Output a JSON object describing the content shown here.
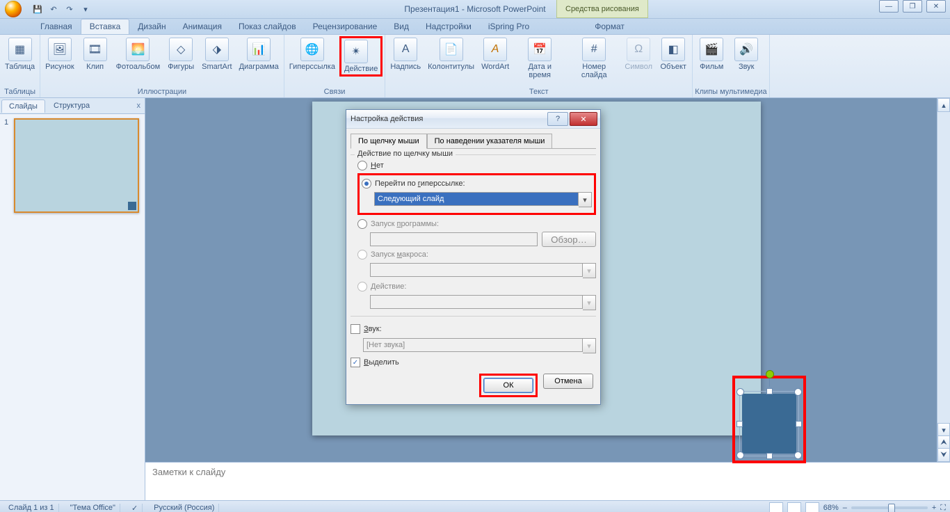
{
  "title": "Презентация1 - Microsoft PowerPoint",
  "drawing_tools_label": "Средства рисования",
  "win": {
    "minimize": "—",
    "restore": "❐",
    "close": "✕"
  },
  "qa": {
    "save": "💾",
    "undo": "↶",
    "redo": "↷",
    "more": "▾"
  },
  "tabs": {
    "home": "Главная",
    "insert": "Вставка",
    "design": "Дизайн",
    "animation": "Анимация",
    "slideshow": "Показ слайдов",
    "review": "Рецензирование",
    "view": "Вид",
    "addins": "Надстройки",
    "ispring": "iSpring Pro",
    "format": "Формат"
  },
  "ribbon": {
    "tables": {
      "title": "Таблицы",
      "table": "Таблица"
    },
    "illustrations": {
      "title": "Иллюстрации",
      "picture": "Рисунок",
      "clip": "Клип",
      "album": "Фотоальбом",
      "shapes": "Фигуры",
      "smartart": "SmartArt",
      "chart": "Диаграмма"
    },
    "links": {
      "title": "Связи",
      "hyperlink": "Гиперссылка",
      "action": "Действие"
    },
    "text": {
      "title": "Текст",
      "textbox": "Надпись",
      "header_footer": "Колонтитулы",
      "wordart": "WordArt",
      "datetime": "Дата и время",
      "slide_number": "Номер слайда",
      "symbol": "Символ",
      "object": "Объект"
    },
    "media": {
      "title": "Клипы мультимедиа",
      "movie": "Фильм",
      "sound": "Звук"
    }
  },
  "icons": {
    "table": "▦",
    "picture": "🖼",
    "clip": "🎞",
    "album": "🌅",
    "shapes": "◇",
    "smartart": "⬗",
    "chart": "📊",
    "hyperlink": "🌐",
    "action": "✴",
    "textbox": "A",
    "header": "📄",
    "wordart": "A",
    "datetime": "📅",
    "number": "#",
    "symbol": "Ω",
    "object": "◧",
    "movie": "🎬",
    "sound": "🔊"
  },
  "slides_pane": {
    "slides": "Слайды",
    "outline": "Структура",
    "close": "x",
    "num1": "1"
  },
  "notes_placeholder": "Заметки к слайду",
  "dialog": {
    "title": "Настройка действия",
    "tab_click": "По щелчку мыши",
    "tab_hover": "По наведении указателя мыши",
    "group": "Действие по щелчку мыши",
    "none": "Нет",
    "hyperlink": "Перейти по гиперссылке:",
    "hyperlink_value": "Следующий слайд",
    "run_program": "Запуск программы:",
    "browse": "Обзор…",
    "run_macro": "Запуск макроса:",
    "action": "Действие:",
    "sound": "Звук:",
    "sound_value": "[Нет звука]",
    "highlight": "Выделить",
    "ok": "ОК",
    "cancel": "Отмена",
    "under_n": "Н",
    "under_rest_none": "ет",
    "under_g": "г",
    "under_rest_hl": "Перейти по ",
    "under_rest_hl2": "иперссылке:",
    "under_p": "п",
    "under_run": "Запуск ",
    "under_run2": "рограммы:",
    "under_m": "м",
    "under_macro": "Запуск ",
    "under_macro2": "акроса:",
    "under_d": "Д",
    "under_act2": "ействие:",
    "under_z": "З",
    "under_sound": "",
    "under_sound2": "вук:",
    "under_v": "В",
    "under_hl2": "ыделить"
  },
  "status": {
    "slide": "Слайд 1 из 1",
    "theme": "\"Тема Office\"",
    "lang": "Русский (Россия)",
    "zoom": "68%",
    "plus": "+",
    "minus": "–",
    "fit": "⛶"
  }
}
